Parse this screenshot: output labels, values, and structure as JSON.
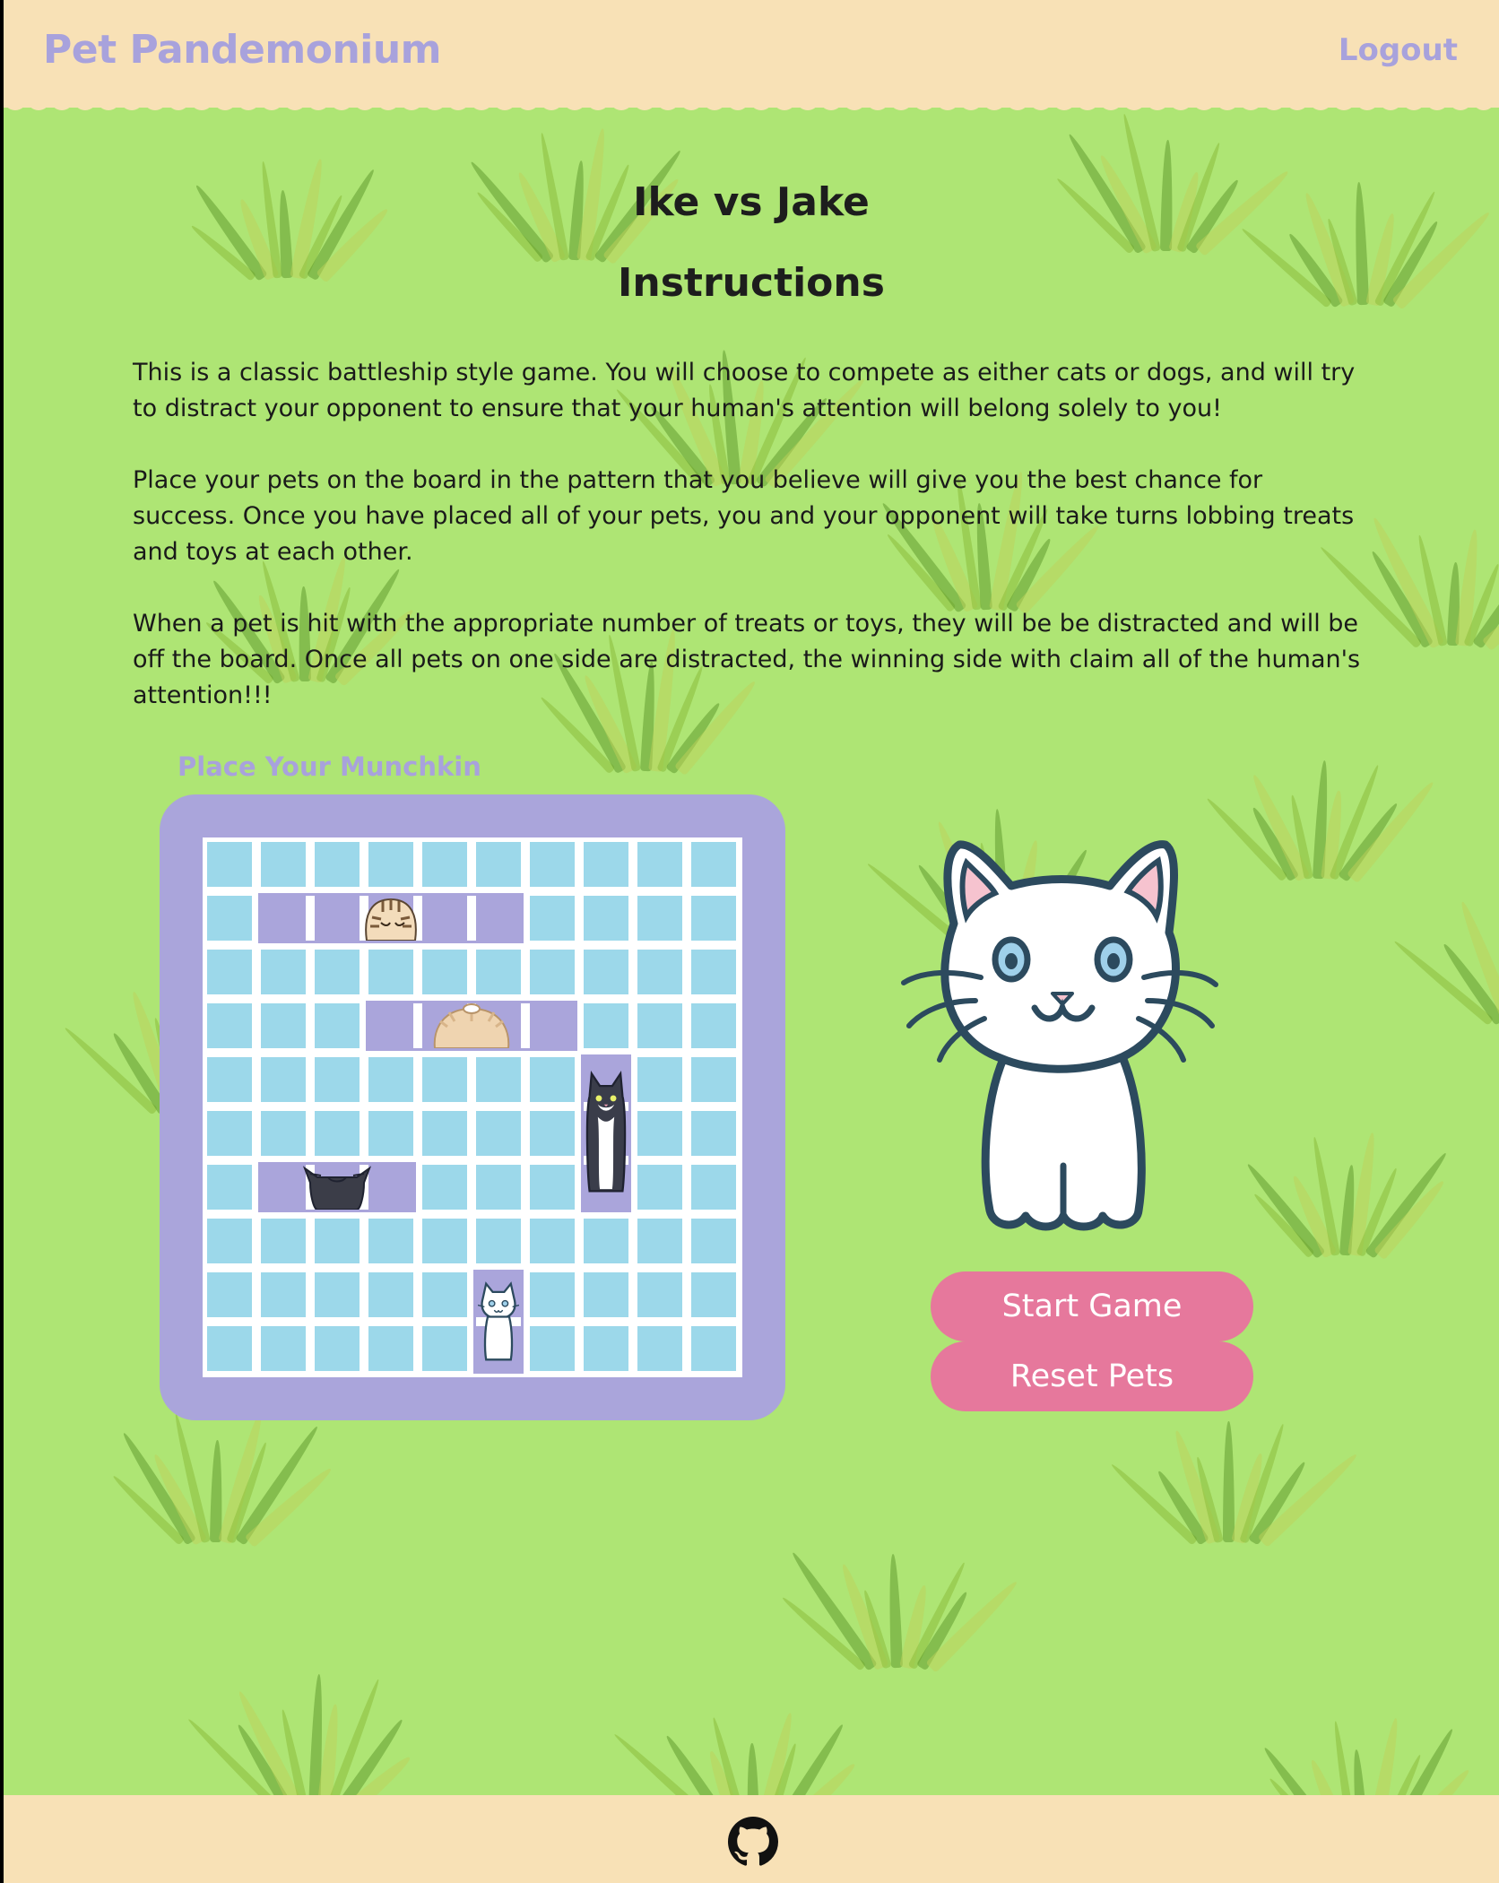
{
  "header": {
    "brand": "Pet Pandemonium",
    "logout_label": "Logout"
  },
  "main": {
    "game_title": "Ike vs Jake",
    "instructions_title": "Instructions",
    "paragraphs": [
      "This is a classic battleship style game. You will choose to compete as either cats or dogs, and will try to distract your opponent to ensure that your human's attention will belong solely to you!",
      "Place your pets on the board in the pattern that you believe will give you the best chance for success. Once you have placed all of your pets, you and your opponent will take turns lobbing treats and toys at each other.",
      "When a pet is hit with the appropriate number of treats or toys, they will be be distracted and will be off the board. Once all pets on one side are distracted, the winning side with claim all of the human's attention!!!"
    ],
    "place_label": "Place Your Munchkin"
  },
  "board": {
    "rows": 10,
    "cols": 10,
    "ships": [
      {
        "name": "tabby-cat",
        "row": 1,
        "col": 1,
        "length": 5,
        "orientation": "horizontal"
      },
      {
        "name": "fluffy-cat",
        "row": 3,
        "col": 3,
        "length": 4,
        "orientation": "horizontal"
      },
      {
        "name": "tuxedo-cat",
        "row": 4,
        "col": 7,
        "length": 3,
        "orientation": "vertical"
      },
      {
        "name": "black-cat",
        "row": 6,
        "col": 1,
        "length": 3,
        "orientation": "horizontal"
      },
      {
        "name": "white-cat",
        "row": 8,
        "col": 5,
        "length": 2,
        "orientation": "vertical"
      }
    ]
  },
  "actions": {
    "start_label": "Start Game",
    "reset_label": "Reset Pets"
  },
  "footer": {
    "icon": "github-icon"
  },
  "colors": {
    "background": "#aee574",
    "header": "#f8e1b6",
    "accent": "#a8a2dc",
    "cell": "#9cd8ea",
    "button": "#e6789c"
  }
}
